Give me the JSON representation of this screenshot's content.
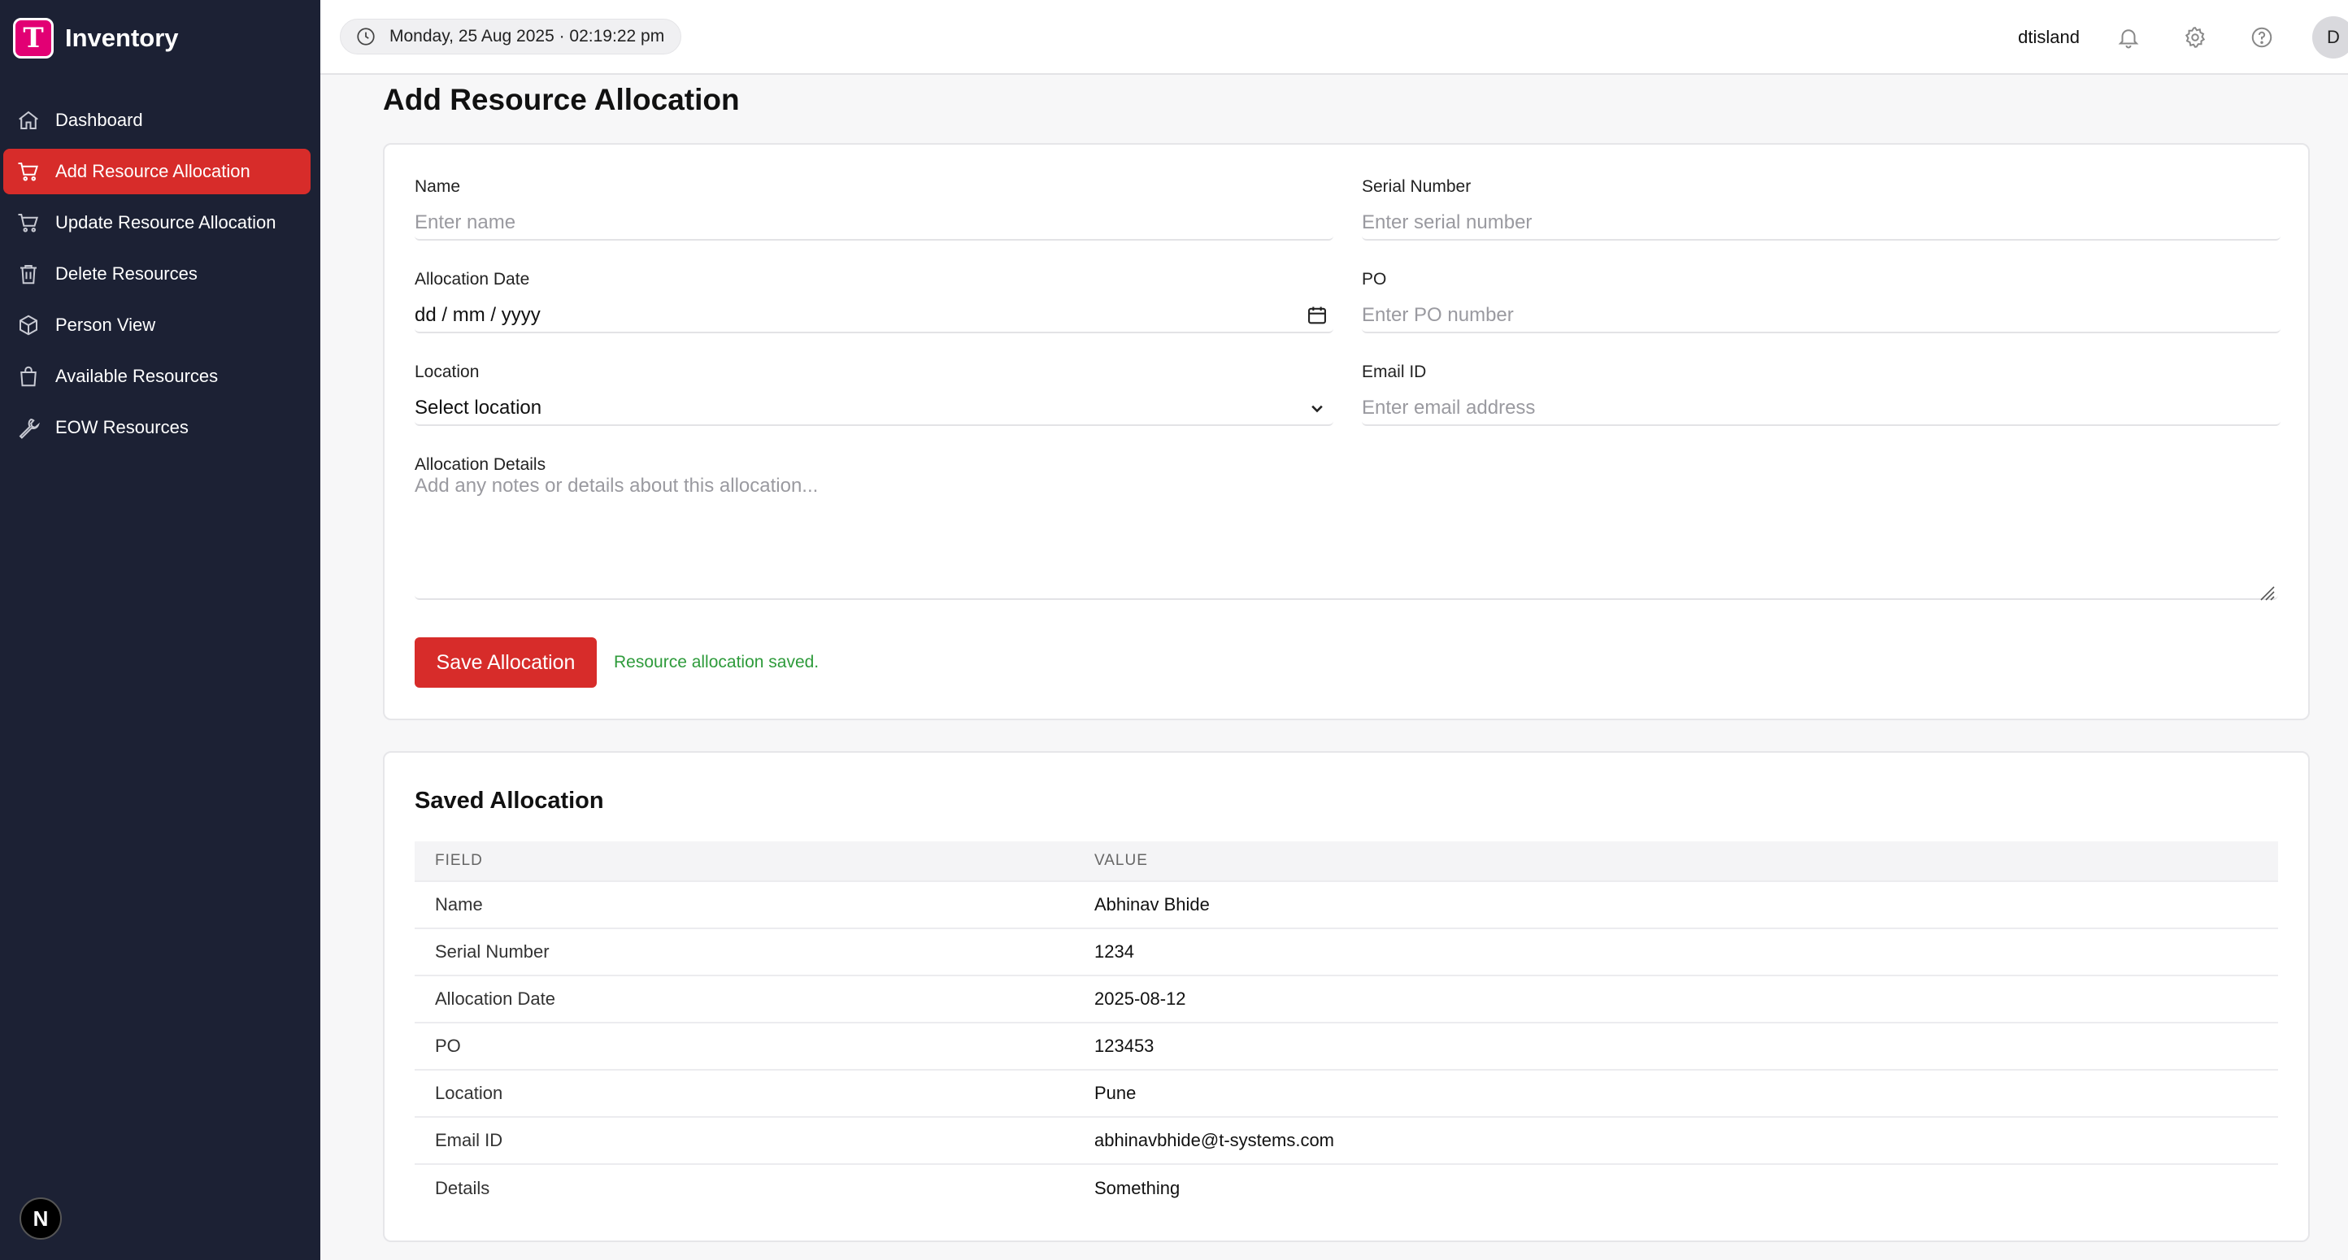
{
  "brand": {
    "name": "Inventory",
    "logo_letter": "T",
    "logo_color": "#e20074"
  },
  "sidebar": {
    "active_color": "#d72c2a",
    "items": [
      {
        "label": "Dashboard",
        "icon": "home-icon"
      },
      {
        "label": "Add Resource Allocation",
        "icon": "cart-icon",
        "active": true
      },
      {
        "label": "Update Resource Allocation",
        "icon": "cart-icon"
      },
      {
        "label": "Delete Resources",
        "icon": "trash-icon"
      },
      {
        "label": "Person View",
        "icon": "box-icon"
      },
      {
        "label": "Available Resources",
        "icon": "bag-icon"
      },
      {
        "label": "EOW Resources",
        "icon": "wrench-icon"
      }
    ],
    "footer_badge": "N"
  },
  "header": {
    "datetime": "Monday, 25 Aug 2025 · 02:19:22 pm",
    "username": "dtisland",
    "avatar_initial": "D",
    "icons": [
      "bell-icon",
      "gear-icon",
      "help-icon"
    ]
  },
  "page": {
    "title": "Add Resource Allocation"
  },
  "form": {
    "name": {
      "label": "Name",
      "placeholder": "Enter name"
    },
    "serial": {
      "label": "Serial Number",
      "placeholder": "Enter serial number"
    },
    "date": {
      "label": "Allocation Date",
      "value": "dd / mm / yyyy"
    },
    "po": {
      "label": "PO",
      "placeholder": "Enter PO number"
    },
    "location": {
      "label": "Location",
      "value": "Select location"
    },
    "email": {
      "label": "Email ID",
      "placeholder": "Enter email address"
    },
    "details": {
      "label": "Allocation Details",
      "placeholder": "Add any notes or details about this allocation..."
    },
    "save_label": "Save Allocation",
    "save_message": "Resource allocation saved."
  },
  "saved": {
    "title": "Saved Allocation",
    "columns": [
      "FIELD",
      "VALUE"
    ],
    "rows": [
      {
        "field": "Name",
        "value": "Abhinav Bhide"
      },
      {
        "field": "Serial Number",
        "value": "1234"
      },
      {
        "field": "Allocation Date",
        "value": "2025-08-12"
      },
      {
        "field": "PO",
        "value": "123453"
      },
      {
        "field": "Location",
        "value": "Pune"
      },
      {
        "field": "Email ID",
        "value": "abhinavbhide@t-systems.com"
      },
      {
        "field": "Details",
        "value": "Something"
      }
    ]
  }
}
